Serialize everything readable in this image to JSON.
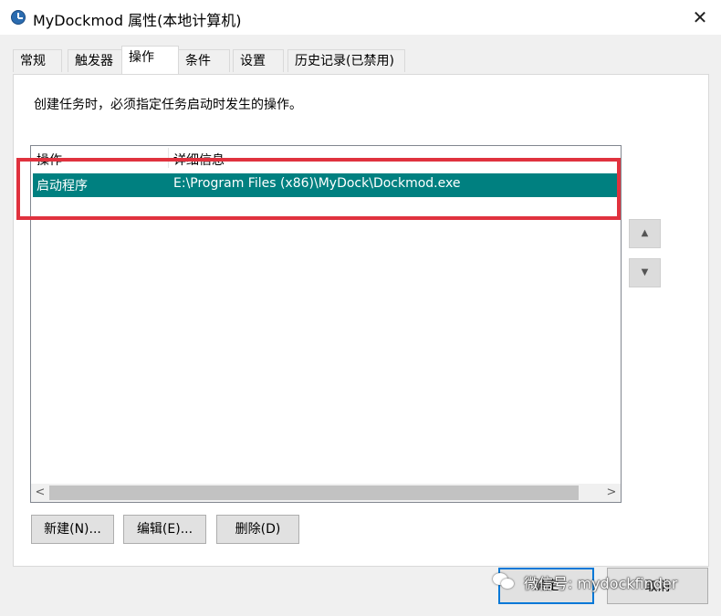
{
  "window": {
    "title": "MyDockmod 属性(本地计算机)",
    "close_glyph": "✕"
  },
  "tabs": [
    {
      "label": "常规"
    },
    {
      "label": "触发器"
    },
    {
      "label": "操作",
      "active": true
    },
    {
      "label": "条件"
    },
    {
      "label": "设置"
    },
    {
      "label": "历史记录(已禁用)"
    }
  ],
  "actions_tab": {
    "instruction": "创建任务时，必须指定任务启动时发生的操作。",
    "columns": [
      "操作",
      "详细信息"
    ],
    "rows": [
      {
        "action": "启动程序",
        "details": "E:\\Program Files (x86)\\MyDock\\Dockmod.exe",
        "selected": true
      }
    ],
    "new_button": "新建(N)...",
    "edit_button": "编辑(E)...",
    "delete_button": "删除(D)",
    "move_up_glyph": "▲",
    "move_down_glyph": "▼",
    "scroll_left_glyph": "<",
    "scroll_right_glyph": ">"
  },
  "footer": {
    "ok_button": "确定",
    "cancel_button": "取消"
  },
  "watermark": {
    "text": "微信号: mydockfinder",
    "icon": "wechat-icon"
  },
  "colors": {
    "selection": "#008080",
    "highlight_border": "#e0323e",
    "default_button_border": "#0078d7"
  }
}
